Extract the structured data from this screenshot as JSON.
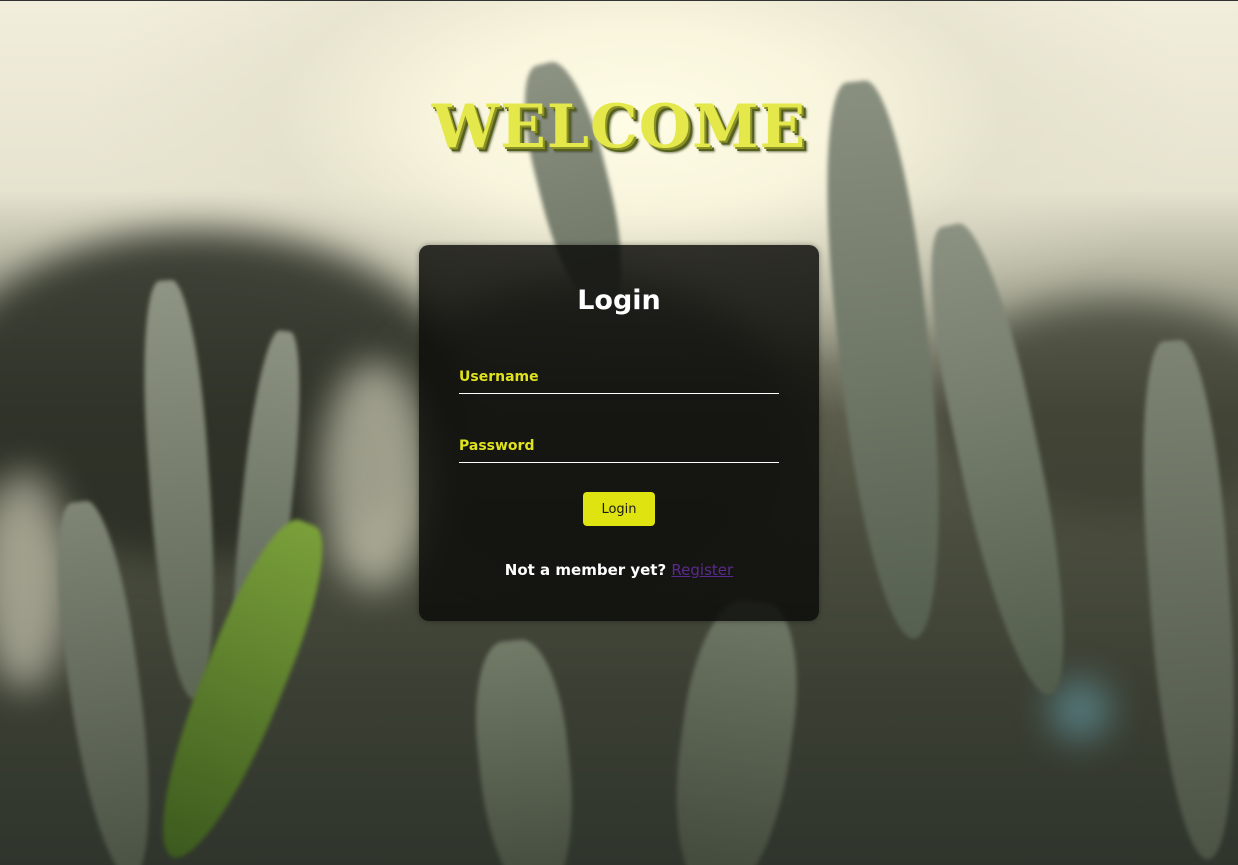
{
  "header": {
    "title": "WELCOME"
  },
  "login_card": {
    "title": "Login",
    "username_label": "Username",
    "password_label": "Password",
    "submit_label": "Login",
    "register_prompt": "Not a member yet?",
    "register_link": "Register"
  },
  "colors": {
    "accent": "#dfe31e",
    "card_background": "#0c0c0a",
    "link": "#5b2a8e"
  },
  "background": {
    "description_icon": "wheat-field-image"
  }
}
